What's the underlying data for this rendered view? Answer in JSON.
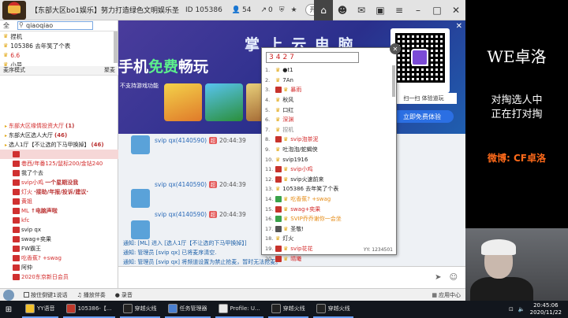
{
  "topbar": {
    "title": "【东部大区bo1娱乐】努力打造绿色文明娱乐圣地/恋...",
    "channel_id": "ID 105386",
    "online_count": "54",
    "share_count": "0",
    "open_toggle": "开播"
  },
  "left_panel": {
    "search_label": "全",
    "search_value": "qiaoqiao",
    "users": [
      {
        "name": "捏机",
        "red": false
      },
      {
        "name": "105386 去年笑了个表",
        "red": false
      },
      {
        "name": "6.6",
        "red": true
      },
      {
        "name": "小号",
        "red": false
      }
    ],
    "mode_label": "麦序模式",
    "mode_right": "聚麦",
    "channels": [
      {
        "label": "东部大区缘情投资大厅",
        "count": "(1)",
        "red": true,
        "sel": false,
        "indent": 0
      },
      {
        "label": "东部大区选人大厅",
        "count": "(46)",
        "red": false,
        "sel": false,
        "indent": 0
      },
      {
        "label": "选人1厅【不让选的下马甲换掉】",
        "count": "(46)",
        "red": false,
        "sel": false,
        "indent": 0
      },
      {
        "label": "",
        "count": "",
        "red": false,
        "sel": true,
        "indent": 2
      },
      {
        "label": "巷西/年番125/鼠标200/金钻240",
        "count": "",
        "red": true,
        "sel": false,
        "indent": 2
      },
      {
        "label": "我了个去",
        "count": "",
        "red": false,
        "sel": false,
        "indent": 2
      },
      {
        "label": "svip小鸡",
        "count": "一个星期没我",
        "red": true,
        "sel": false,
        "indent": 2
      },
      {
        "label": "灯火",
        "count": "·接助/年报/投诉/建议·",
        "red": true,
        "sel": false,
        "indent": 2
      },
      {
        "label": "黄姐",
        "count": "",
        "red": true,
        "sel": false,
        "indent": 2
      },
      {
        "label": "ML",
        "count": "↑电脑声啦",
        "red": true,
        "sel": false,
        "indent": 2
      },
      {
        "label": "kfc",
        "count": "",
        "red": true,
        "sel": false,
        "indent": 2
      },
      {
        "label": "svip qx",
        "count": "",
        "red": false,
        "sel": false,
        "indent": 2
      },
      {
        "label": "swag+奕果",
        "count": "",
        "red": false,
        "sel": false,
        "indent": 2
      },
      {
        "label": "FW霸王",
        "count": "",
        "red": false,
        "sel": false,
        "indent": 2
      },
      {
        "label": "吃香蕉? +swag",
        "count": "",
        "red": true,
        "sel": false,
        "indent": 2
      },
      {
        "label": "阿仲",
        "count": "",
        "red": false,
        "sel": false,
        "indent": 2
      },
      {
        "label": "2020东京新日会员",
        "count": "",
        "red": true,
        "sel": false,
        "indent": 2
      }
    ]
  },
  "banner": {
    "title": "掌 上 云 电 脑",
    "free_prefix": "手机",
    "free_green": "免费",
    "free_suffix": "畅玩",
    "note": "不支持游戏功能",
    "qr_caption": "扫一扫 体验道玩",
    "free_exp": "立即免费体验"
  },
  "chat": {
    "messages": [
      {
        "name": "svip qx(4140590)",
        "tag": "超",
        "time": "20:44:39"
      },
      {
        "name": "svip qx(4140590)",
        "tag": "超",
        "time": "20:44:39"
      },
      {
        "name": "svip qx(4140590)",
        "tag": "超",
        "time": "20:44:39"
      }
    ],
    "system": [
      {
        "tag": "通知:",
        "text": "[ML] 进入 [选人1厅【不让选的下马甲换掉】]"
      },
      {
        "tag": "通知:",
        "text": "管理员 [svip qx] 已将麦序清空."
      },
      {
        "tag": "通知:",
        "text": "管理员 [svip qx] 将频道设置为禁止抢麦，暂时无法抢麦。"
      }
    ]
  },
  "bottom_bar": {
    "items": [
      "按住倒键1说话",
      "播放伴奏",
      "录音"
    ],
    "app_center": "应用中心"
  },
  "popup": {
    "search_value": "3427",
    "results": [
      {
        "num": "1.",
        "name": "●t1",
        "style": "",
        "mark": ""
      },
      {
        "num": "2.",
        "name": "7An",
        "style": "",
        "mark": ""
      },
      {
        "num": "3.",
        "name": "暴雨",
        "style": "red",
        "mark": "#c7332c"
      },
      {
        "num": "4.",
        "name": "秋风",
        "style": "",
        "mark": ""
      },
      {
        "num": "5.",
        "name": "口红",
        "style": "",
        "mark": ""
      },
      {
        "num": "6.",
        "name": "深渊",
        "style": "red",
        "mark": ""
      },
      {
        "num": "7.",
        "name": "捏机",
        "style": "gray",
        "mark": ""
      },
      {
        "num": "8.",
        "name": "svip泡茶泥",
        "style": "red",
        "mark": "#c7332c"
      },
      {
        "num": "9.",
        "name": "吐泡泡/蛇蝎侠",
        "style": "",
        "mark": ""
      },
      {
        "num": "10.",
        "name": "svip1916",
        "style": "",
        "mark": ""
      },
      {
        "num": "11.",
        "name": "svip小鸡",
        "style": "red",
        "mark": "#c7332c"
      },
      {
        "num": "12.",
        "name": "svip火速前来",
        "style": "",
        "mark": "#c7332c"
      },
      {
        "num": "13.",
        "name": "105386 去年笑了个表",
        "style": "",
        "mark": ""
      },
      {
        "num": "14.",
        "name": "吃香蕉? +swag",
        "style": "orange",
        "mark": "#3aa24a"
      },
      {
        "num": "15.",
        "name": "swag+奕果",
        "style": "red",
        "mark": "#c7332c"
      },
      {
        "num": "16.",
        "name": "SVIP乔乔谢你一会坐",
        "style": "orange",
        "mark": "#3aa24a"
      },
      {
        "num": "17.",
        "name": "圣敬!",
        "style": "",
        "mark": "#555"
      },
      {
        "num": "18.",
        "name": "灯火",
        "style": "",
        "mark": ""
      },
      {
        "num": "19.",
        "name": "svip花花",
        "style": "red",
        "mark": "#c7332c"
      },
      {
        "num": "20.",
        "name": "晴曦",
        "style": "red",
        "mark": "#c7332c"
      }
    ],
    "footer": "YY: 1234501"
  },
  "right_panel": {
    "title": "WE卓洛",
    "status_line1": "对掏选人中",
    "status_line2": "正在打对掏",
    "weibo": "微博: CF卓洛"
  },
  "taskbar": {
    "tasks": [
      "YY语音",
      "105386-【...",
      "穿越火线",
      "任务管理器",
      "Profile: U...",
      "穿越火线",
      "穿越火线"
    ],
    "time": "20:45:06",
    "date": "2020/11/22"
  },
  "colors": {
    "accent_red": "#d32b2b",
    "link_blue": "#2a6ab8",
    "banner_green": "#5cf08c",
    "weibo_orange": "#ff6a1a"
  }
}
